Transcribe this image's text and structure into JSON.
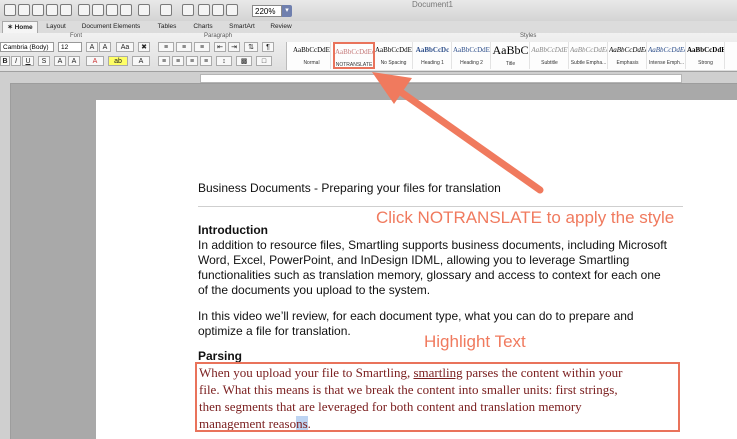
{
  "window": {
    "doc_title": "Document1",
    "zoom": "220%"
  },
  "tabs": [
    "Home",
    "Layout",
    "Document Elements",
    "Tables",
    "Charts",
    "SmartArt",
    "Review"
  ],
  "ribbon": {
    "groups": [
      "Font",
      "Paragraph",
      "Styles"
    ],
    "font_name": "Cambria (Body)",
    "font_size": "12",
    "styles": [
      {
        "sample": "AaBbCcDdEe",
        "name": "Normal"
      },
      {
        "sample": "AaBbCcDdEe",
        "name": "NOTRANSLATE"
      },
      {
        "sample": "AaBbCcDdEe",
        "name": "No Spacing"
      },
      {
        "sample": "AaBbCcDc",
        "name": "Heading 1"
      },
      {
        "sample": "AaBbCcDdEe",
        "name": "Heading 2"
      },
      {
        "sample": "AaBbC",
        "name": "Title"
      },
      {
        "sample": "AaBbCcDdE",
        "name": "Subtitle"
      },
      {
        "sample": "AaBbCcDdEe",
        "name": "Subtle Empha..."
      },
      {
        "sample": "AaBbCcDdEe",
        "name": "Emphasis"
      },
      {
        "sample": "AaBbCcDdEe",
        "name": "Intense Emph..."
      },
      {
        "sample": "AaBbCcDdE",
        "name": "Strong"
      }
    ]
  },
  "document": {
    "title": "Business Documents - Preparing your files for translation",
    "intro_heading": "Introduction",
    "intro_lines": [
      "In addition to resource files, Smartling supports business documents, including Microsoft",
      "Word, Excel, PowerPoint, and InDesign IDML, allowing you to leverage Smartling",
      "functionalities such as translation memory, glossary and access to context for each one",
      "of the documents you upload to the system."
    ],
    "video_lines": [
      "In this video we’ll review, for each document type, what you can do to prepare and",
      "optimize a file for translation."
    ],
    "parsing_heading": "Parsing",
    "parsing": {
      "line1_pre": "When you upload your file to Smartling, ",
      "line1_underlined": "smartling",
      "line1_post": " parses the content within your",
      "line2": "file. What this means is that we break the content into smaller units: first strings,",
      "line3": "then segments that are leveraged for both content and translation memory",
      "line4_pre": "management reaso",
      "line4_selected": "ns",
      "line4_post": "."
    }
  },
  "annotations": {
    "click_notranslate": "Click NOTRANSLATE to apply the style",
    "highlight_text": "Highlight Text",
    "accent_color": "#e9735b"
  }
}
